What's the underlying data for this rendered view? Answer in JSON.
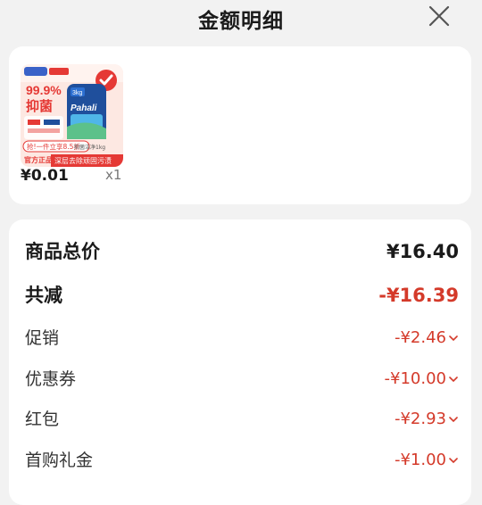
{
  "header": {
    "title": "金额明细"
  },
  "product": {
    "price": "¥0.01",
    "quantity": "x1",
    "thumb_text": {
      "pct": "99.9%",
      "antibac": "抑菌",
      "brand": "Pahali",
      "badge": "抢!一件立享8.5折",
      "official": "官方正品",
      "slogan": "深层去除顽固污渍",
      "spec": "3kg",
      "pack_label": "抑菌洁净1kg"
    }
  },
  "details": {
    "total_label": "商品总价",
    "total_value": "¥16.40",
    "reduce_label": "共减",
    "reduce_value": "-¥16.39",
    "items": [
      {
        "label": "促销",
        "value": "-¥2.46"
      },
      {
        "label": "优惠券",
        "value": "-¥10.00"
      },
      {
        "label": "红包",
        "value": "-¥2.93"
      },
      {
        "label": "首购礼金",
        "value": "-¥1.00"
      }
    ]
  },
  "colors": {
    "accent_red": "#d43a2a",
    "text_dark": "#1a1a1a",
    "bg": "#f2f2f2"
  }
}
